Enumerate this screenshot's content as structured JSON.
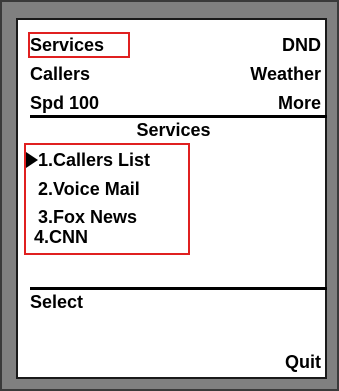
{
  "softkeys_top": {
    "row1_left": "Services",
    "row1_right": "DND",
    "row2_left": "Callers",
    "row2_right": "Weather",
    "row3_left": "Spd 100",
    "row3_right": "More"
  },
  "menu": {
    "title": "Services",
    "items": [
      "1.Callers List",
      "2.Voice Mail",
      "3.Fox News",
      "4.CNN"
    ],
    "selected_index": 0
  },
  "softkeys_bottom": {
    "left": "Select",
    "right": "Quit"
  },
  "colors": {
    "highlight": "#e02020",
    "bezel": "#808080",
    "screen": "#ffffff"
  },
  "icons": {
    "selection": "selection-arrow-icon"
  }
}
